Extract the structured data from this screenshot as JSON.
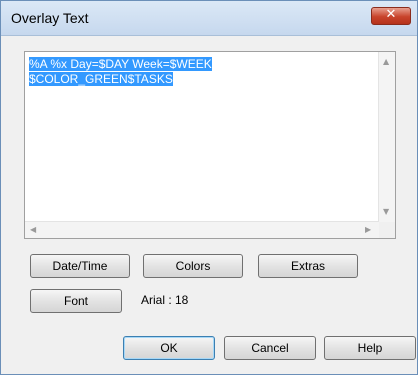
{
  "window": {
    "title": "Overlay Text",
    "close_icon": "close-icon"
  },
  "editor": {
    "lines": [
      "%A %x Day=$DAY Week=$WEEK",
      "$COLOR_GREEN$TASKS"
    ],
    "selection_color": "#3399ff"
  },
  "buttons": {
    "datetime": "Date/Time",
    "colors": "Colors",
    "extras": "Extras",
    "font": "Font",
    "ok": "OK",
    "cancel": "Cancel",
    "help": "Help"
  },
  "font_info": "Arial : 18"
}
